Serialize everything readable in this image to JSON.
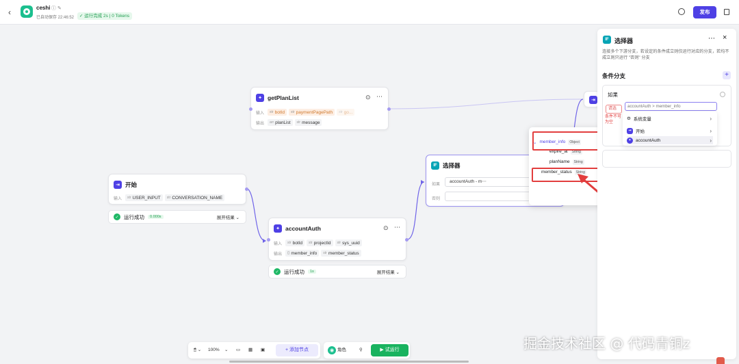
{
  "header": {
    "back_icon": "‹",
    "app_name": "ceshi",
    "info_icon": "ⓘ ✎",
    "save_info": "已自动保存 22:46:52",
    "run_badge": "✓ 运行完成 2s | 0 Tokens",
    "publish_label": "发布"
  },
  "nodes": {
    "getplanlist": {
      "title": "getPlanList",
      "input_label": "输入",
      "inputs": [
        "botId",
        "paymentPagePath",
        "go..."
      ],
      "output_label": "输出",
      "outputs": [
        "planList",
        "message"
      ]
    },
    "start": {
      "title": "开始",
      "input_label": "输入",
      "inputs": [
        "USER_INPUT",
        "CONVERSATION_NAME"
      ],
      "status_label": "运行成功",
      "time": "0.000s",
      "expand_label": "展开结果 ⌄"
    },
    "accountauth": {
      "title": "accountAuth",
      "input_label": "输入",
      "inputs": [
        "botId",
        "projectId",
        "sys_uuid"
      ],
      "output_label": "输出",
      "outputs": [
        "member_info",
        "member_status"
      ],
      "status_label": "运行成功",
      "time": "1s",
      "expand_label": "展开结果 ⌄"
    },
    "selector": {
      "title": "选择器",
      "if_label": "如果",
      "if_value": "accountAuth - m⋯",
      "else_label": "否则"
    }
  },
  "popup": {
    "items": [
      {
        "name": "member_info",
        "type": "Object"
      },
      {
        "name": "expire_at",
        "type": "String"
      },
      {
        "name": "planName",
        "type": "String"
      },
      {
        "name": "member_status",
        "type": "String"
      }
    ]
  },
  "submenu": {
    "items": [
      "系统变量",
      "开始",
      "accountAuth"
    ]
  },
  "panel": {
    "title": "选择器",
    "more_icon": "⋯",
    "close_icon": "×",
    "description": "连接多个下游分支，若设定的条件成立则仅运行对应的分支，若均不成立则只运行 \"否则\" 分支",
    "section_title": "条件分支",
    "if_label": "如果",
    "op_placeholder": "请选",
    "error_text": "条件不可为空",
    "var_value": "accountAuth > member_info"
  },
  "toolbar": {
    "zoom": "100%",
    "add_node": "+ 添加节点",
    "role": "角色",
    "test_run": "▶ 试运行"
  },
  "watermark": "掘金技术社区 @ 代码青铜z",
  "colors": {
    "accent": "#4e40e5",
    "success": "#1fb866",
    "error": "#e23d3d",
    "if_node": "#07a4b5"
  }
}
